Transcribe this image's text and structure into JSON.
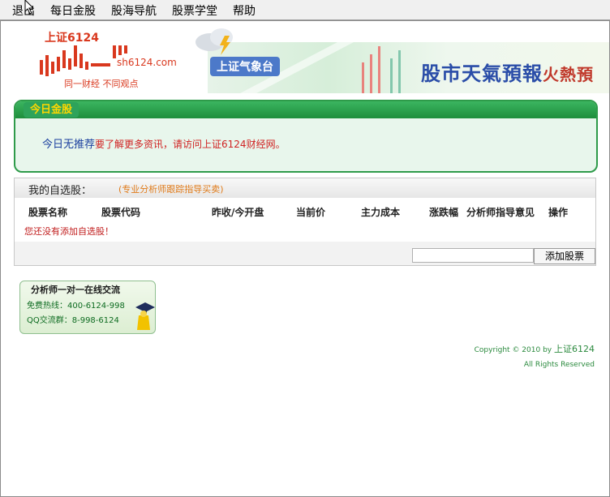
{
  "menu": {
    "items": [
      "退出",
      "每日金股",
      "股海导航",
      "股票学堂",
      "帮助"
    ]
  },
  "logo": {
    "name": "上证6124",
    "site": "sh6124.com",
    "slogan": "同一财经  不同观点"
  },
  "banner": {
    "badge": "上证气象台",
    "headline": "股市天氣預報",
    "headline_hot": "火熱預"
  },
  "gold": {
    "title": "今日金股",
    "none": "今日无推荐",
    "more": "要了解更多资讯，请访问",
    "site": "上证6124",
    "tail": "财经网。"
  },
  "watch": {
    "title": "我的自选股：",
    "subtitle": "(专业分析师跟踪指导买卖)",
    "columns": [
      "股票名称",
      "股票代码",
      "昨收/今开盘",
      "当前价",
      "主力成本",
      "涨跌幅",
      "分析师指导意见",
      "操作"
    ],
    "empty": "您还没有添加自选股！",
    "input_value": "",
    "add_button": "添加股票"
  },
  "chat": {
    "title": "分析师一对一在线交流",
    "hotline": "免费热线：400-6124-998",
    "qq": "QQ交流群：8-998-6124"
  },
  "footer": {
    "copyright_prefix": "Copyright © 2010 by",
    "brand": "上证6124",
    "rights": "All Rights Reserved"
  },
  "colors": {
    "green": "#2e9b4a",
    "gold": "#ffd700",
    "red": "#d02222",
    "blue": "#1a3f9e"
  }
}
